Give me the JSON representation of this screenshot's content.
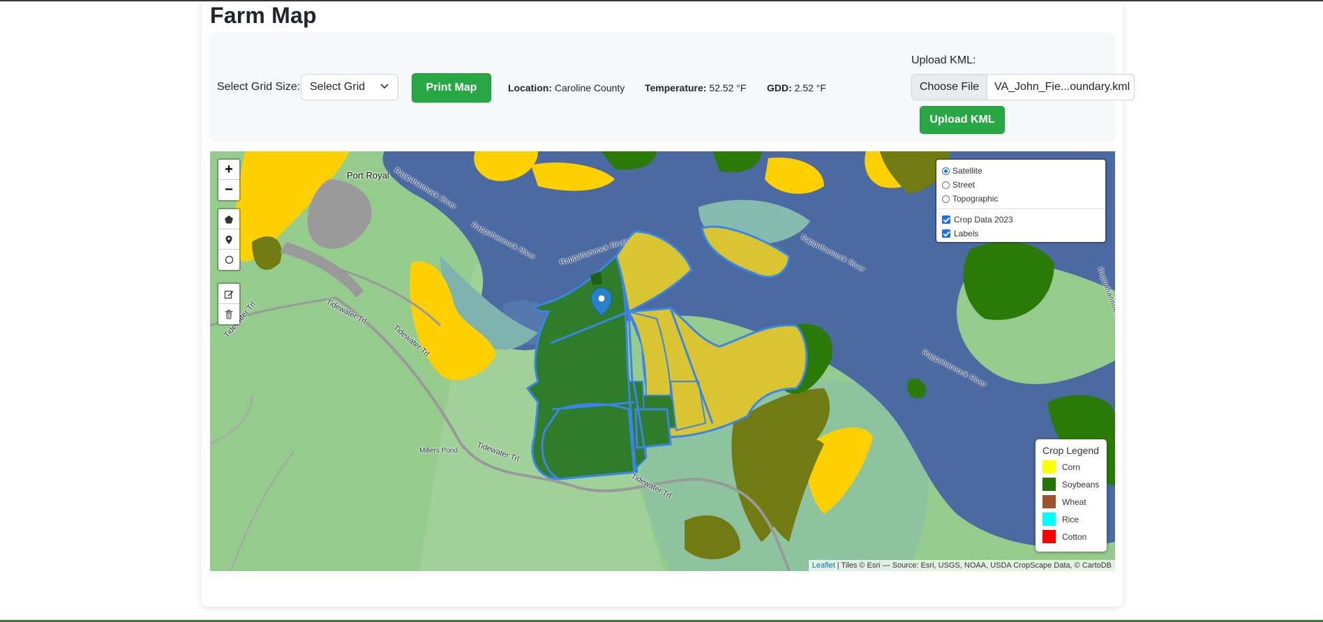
{
  "page": {
    "title": "Farm Map"
  },
  "controls": {
    "grid_label": "Select Grid Size:",
    "grid_select_value": "Select Grid",
    "print_label": "Print Map",
    "location_label": "Location:",
    "location_value": "Caroline County",
    "temperature_label": "Temperature:",
    "temperature_value": "52.52 °F",
    "gdd_label": "GDD:",
    "gdd_value": "2.52 °F",
    "kml_label": "Upload KML:",
    "file_button": "Choose File",
    "file_name": "VA_John_Fie...oundary.kml",
    "upload_label": "Upload KML"
  },
  "map": {
    "zoom_in": "+",
    "zoom_out": "−",
    "draw_tools": [
      "polygon-icon",
      "marker-icon",
      "circle-icon"
    ],
    "edit_tools": [
      "edit-icon",
      "trash-icon"
    ],
    "base_layers": [
      {
        "label": "Satellite",
        "selected": true
      },
      {
        "label": "Street",
        "selected": false
      },
      {
        "label": "Topographic",
        "selected": false
      }
    ],
    "overlays": [
      {
        "label": "Crop Data 2023",
        "checked": true
      },
      {
        "label": "Labels",
        "checked": true
      }
    ],
    "labels": {
      "place": "Port Royal",
      "river_1": "Rappahannock River",
      "river_2": "Rappahannock River",
      "river_3": "Rappahannock River",
      "river_4": "Rappahannock River",
      "river_5": "Rappahannock River",
      "river_6": "Rappahannock River",
      "road_1": "Tidewater Trl",
      "road_2": "Tidewater Trl",
      "road_3": "Tidewater Trl",
      "road_4": "Tidewater Trl",
      "road_5": "Tidewater Trl",
      "pond": "Millers Pond"
    },
    "legend": {
      "title": "Crop Legend",
      "items": [
        {
          "label": "Corn",
          "color": "#ffff00"
        },
        {
          "label": "Soybeans",
          "color": "#267300"
        },
        {
          "label": "Wheat",
          "color": "#a0522d"
        },
        {
          "label": "Rice",
          "color": "#00ffff"
        },
        {
          "label": "Cotton",
          "color": "#ff0000"
        }
      ]
    },
    "attribution_link": "Leaflet",
    "attribution_text": " | Tiles © Esri — Source: Esri, USGS, NOAA, USDA CropScape Data, © CartoDB"
  },
  "colors": {
    "accent_green": "#28a745",
    "water": "#4a6aa1",
    "corn": "#ffd000",
    "soybeans": "#267300",
    "field_outline": "#3a86e8"
  }
}
